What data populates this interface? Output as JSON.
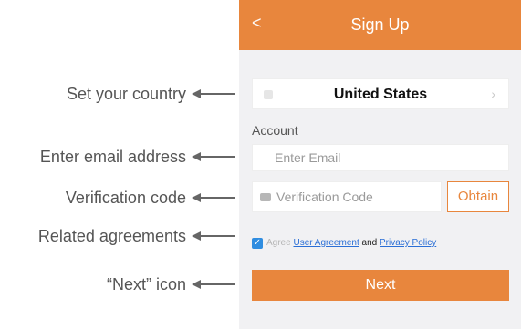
{
  "header": {
    "back_glyph": "<",
    "title": "Sign Up"
  },
  "form": {
    "country_value": "United States",
    "account_label": "Account",
    "email_placeholder": "Enter Email",
    "code_placeholder": "Verification Code",
    "obtain_label": "Obtain",
    "agree": {
      "prefix": "Agree",
      "user_agreement": "User Agreement",
      "and": "and",
      "privacy_policy": "Privacy Policy"
    },
    "next_label": "Next"
  },
  "callouts": [
    {
      "text": "Set your country"
    },
    {
      "text": "Enter email address"
    },
    {
      "text": "Verification code"
    },
    {
      "text": "Related agreements"
    },
    {
      "text": "“Next” icon"
    }
  ],
  "colors": {
    "accent": "#e8863d",
    "link": "#2b6fd6",
    "checkbox": "#2f8de0"
  }
}
